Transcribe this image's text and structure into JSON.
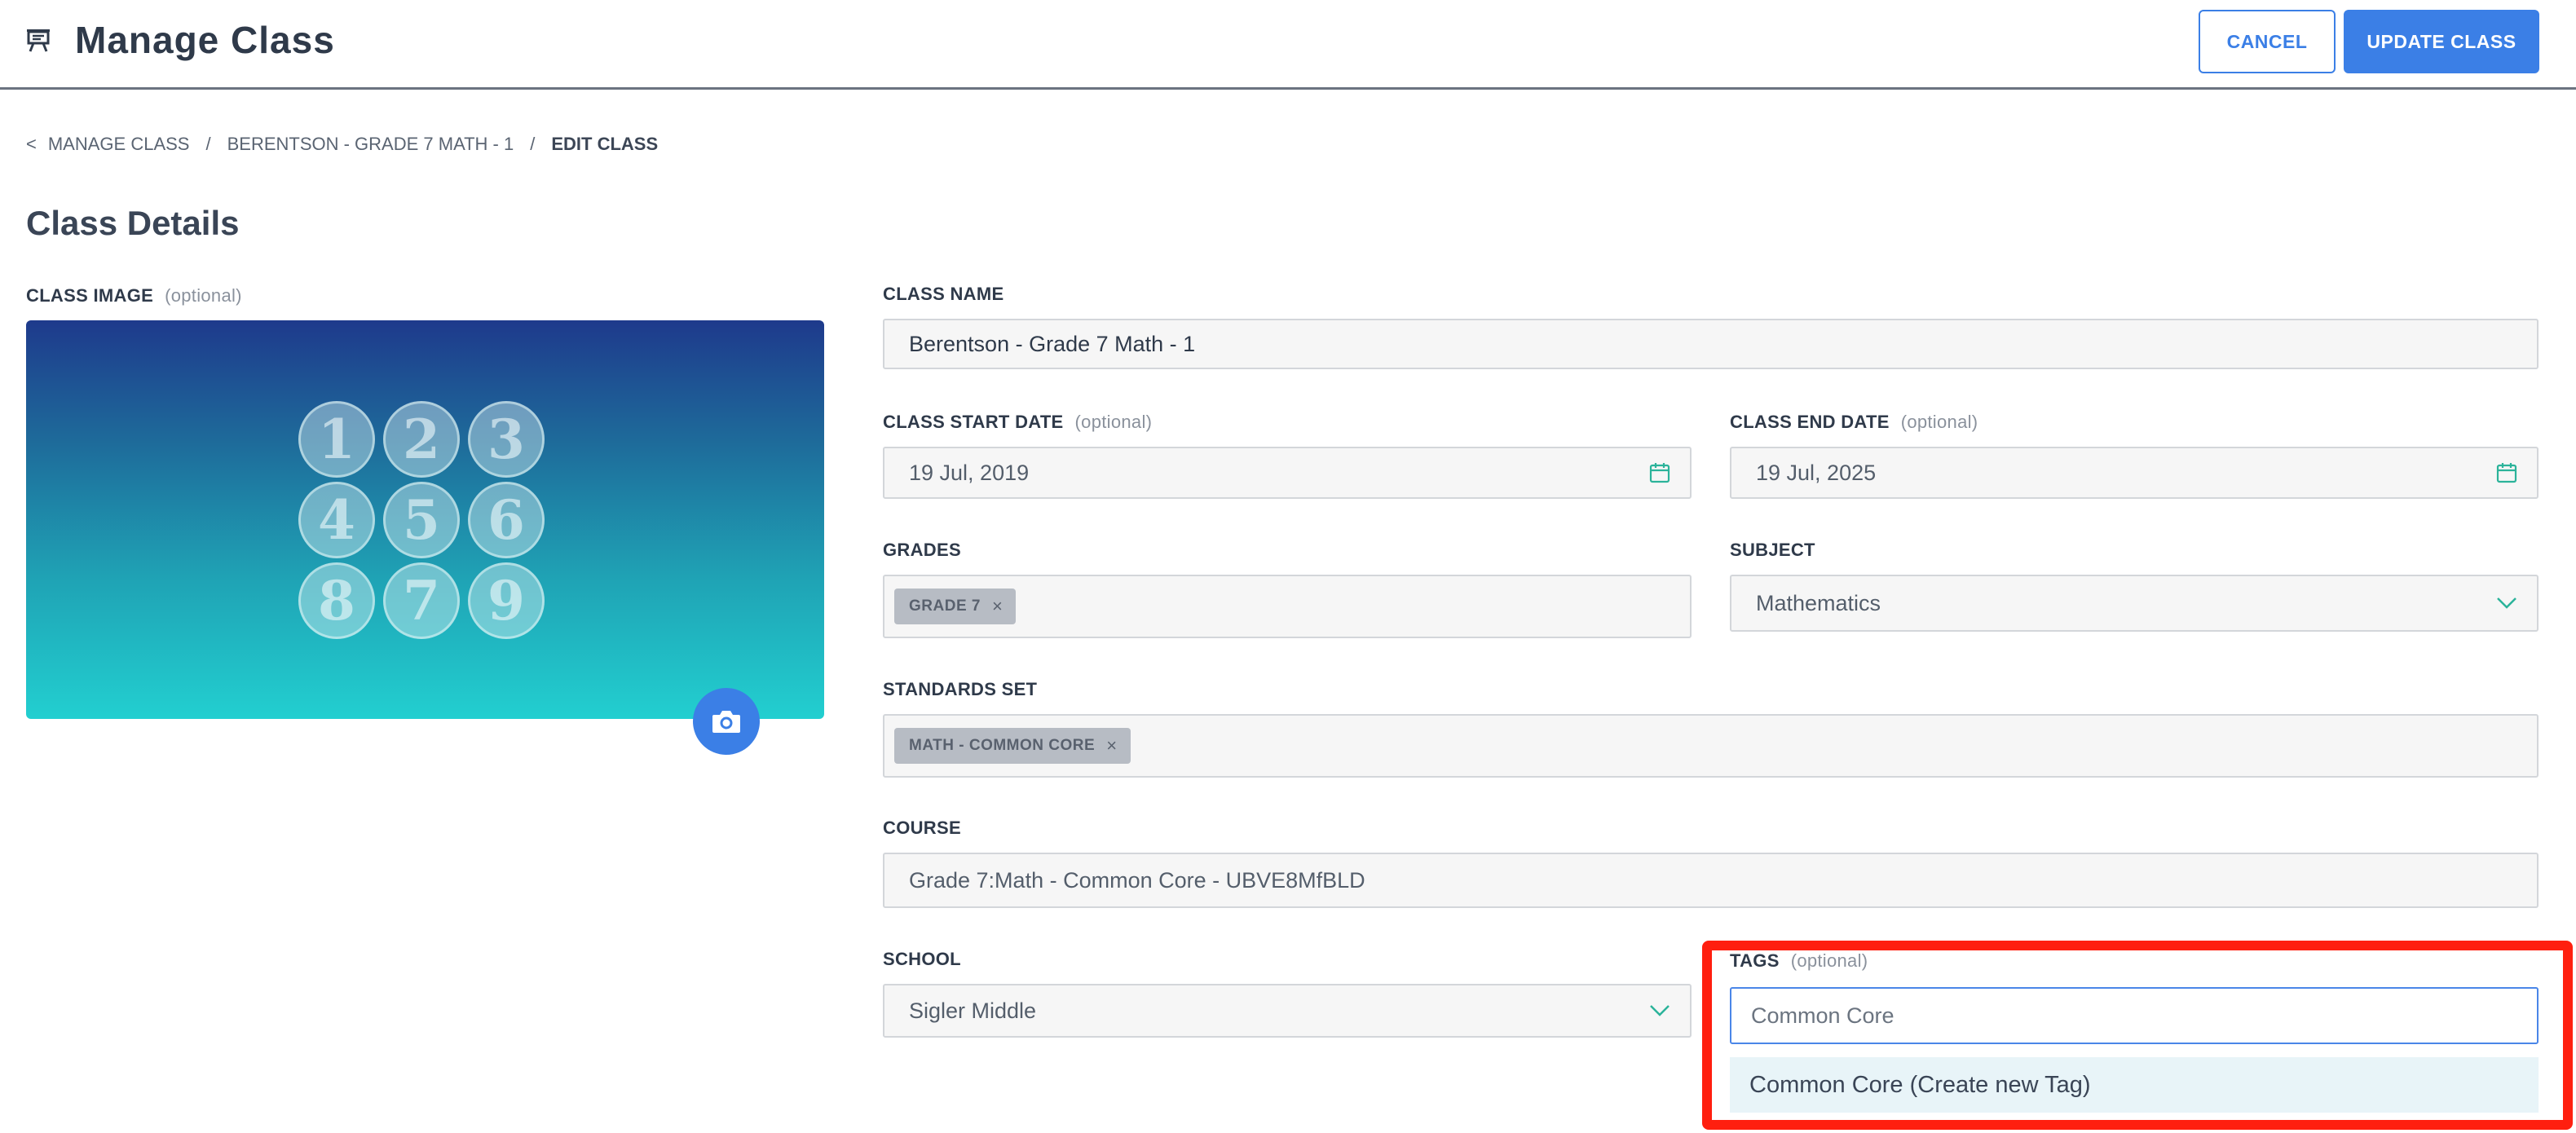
{
  "header": {
    "title": "Manage Class",
    "cancel_label": "CANCEL",
    "update_label": "UPDATE CLASS"
  },
  "breadcrumb": {
    "back_symbol": "<",
    "items": [
      "MANAGE CLASS",
      "BERENTSON - GRADE 7 MATH - 1",
      "EDIT CLASS"
    ],
    "separator": "/"
  },
  "section_title": "Class Details",
  "class_image": {
    "label": "CLASS IMAGE",
    "optional": "(optional)",
    "numbers": [
      "1",
      "2",
      "3",
      "4",
      "5",
      "6",
      "8",
      "7",
      "9"
    ]
  },
  "fields": {
    "class_name": {
      "label": "CLASS NAME",
      "value": "Berentson - Grade 7 Math - 1"
    },
    "start_date": {
      "label": "CLASS START DATE",
      "optional": "(optional)",
      "value": "19 Jul, 2019"
    },
    "end_date": {
      "label": "CLASS END DATE",
      "optional": "(optional)",
      "value": "19 Jul, 2025"
    },
    "grades": {
      "label": "GRADES",
      "chips": [
        "GRADE 7"
      ]
    },
    "subject": {
      "label": "SUBJECT",
      "value": "Mathematics"
    },
    "standards": {
      "label": "STANDARDS SET",
      "chips": [
        "MATH - COMMON CORE"
      ]
    },
    "course": {
      "label": "COURSE",
      "value": "Grade 7:Math - Common Core - UBVE8MfBLD"
    },
    "school": {
      "label": "SCHOOL",
      "value": "Sigler Middle"
    },
    "tags": {
      "label": "TAGS",
      "optional": "(optional)",
      "value": "Common Core",
      "suggestion": "Common Core (Create new Tag)"
    }
  },
  "chip_remove_symbol": "×",
  "colors": {
    "accent": "#3b7fe6",
    "highlight": "#ff1f0f",
    "icon_green": "#2bb39a"
  },
  "icons": [
    "presentation-board-icon",
    "calendar-icon",
    "chevron-down-icon",
    "camera-icon",
    "close-icon"
  ]
}
